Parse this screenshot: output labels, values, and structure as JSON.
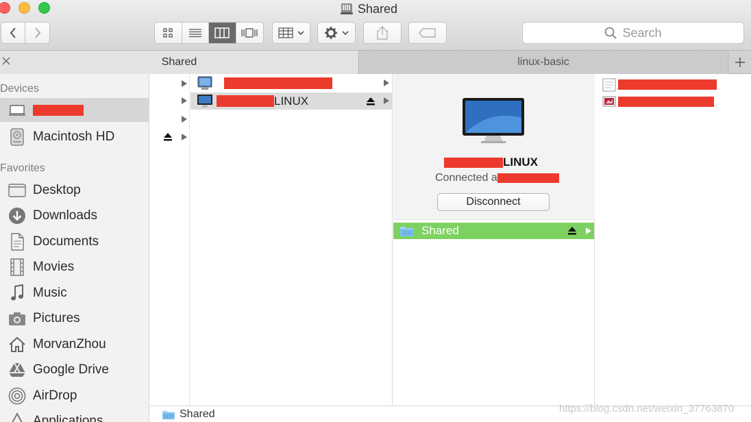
{
  "window": {
    "title": "Shared"
  },
  "search": {
    "placeholder": "Search"
  },
  "tabs": [
    {
      "label": "Shared"
    },
    {
      "label": "linux-basic"
    }
  ],
  "sidebar": {
    "devices_heading": "Devices",
    "favorites_heading": "Favorites",
    "devices": [
      {
        "label": "",
        "icon": "laptop-icon"
      },
      {
        "label": "Macintosh HD",
        "icon": "hard-drive-icon"
      }
    ],
    "favorites": [
      {
        "label": "Desktop",
        "icon": "desktop-icon"
      },
      {
        "label": "Downloads",
        "icon": "downloads-icon"
      },
      {
        "label": "Documents",
        "icon": "documents-icon"
      },
      {
        "label": "Movies",
        "icon": "movies-icon"
      },
      {
        "label": "Music",
        "icon": "music-icon"
      },
      {
        "label": "Pictures",
        "icon": "pictures-icon"
      },
      {
        "label": "MorvanZhou",
        "icon": "home-icon"
      },
      {
        "label": "Google Drive",
        "icon": "google-drive-icon"
      },
      {
        "label": "AirDrop",
        "icon": "airdrop-icon"
      },
      {
        "label": "Applications",
        "icon": "applications-icon"
      }
    ]
  },
  "column2": {
    "items": [
      {
        "label": "",
        "icon": "network-computer-icon"
      },
      {
        "label": "LINUX",
        "icon": "monitor-icon"
      }
    ]
  },
  "preview": {
    "name_suffix": "LINUX",
    "connected_prefix": "Connected a",
    "disconnect_label": "Disconnect"
  },
  "column3": {
    "items": [
      {
        "label": "Shared",
        "icon": "shared-folder-icon"
      }
    ]
  },
  "column4": {
    "items": [
      {
        "label": "",
        "icon": "png-file-icon"
      },
      {
        "label": "",
        "icon": "png-file-icon"
      }
    ]
  },
  "statusbar": {
    "path_label": "Shared"
  },
  "watermark": "https://blog.csdn.net/weixin_37763870",
  "colors": {
    "selection_green": "#7dd160",
    "redaction_red": "#ec3b2c",
    "sidebar_bg": "#f2f2f2"
  }
}
